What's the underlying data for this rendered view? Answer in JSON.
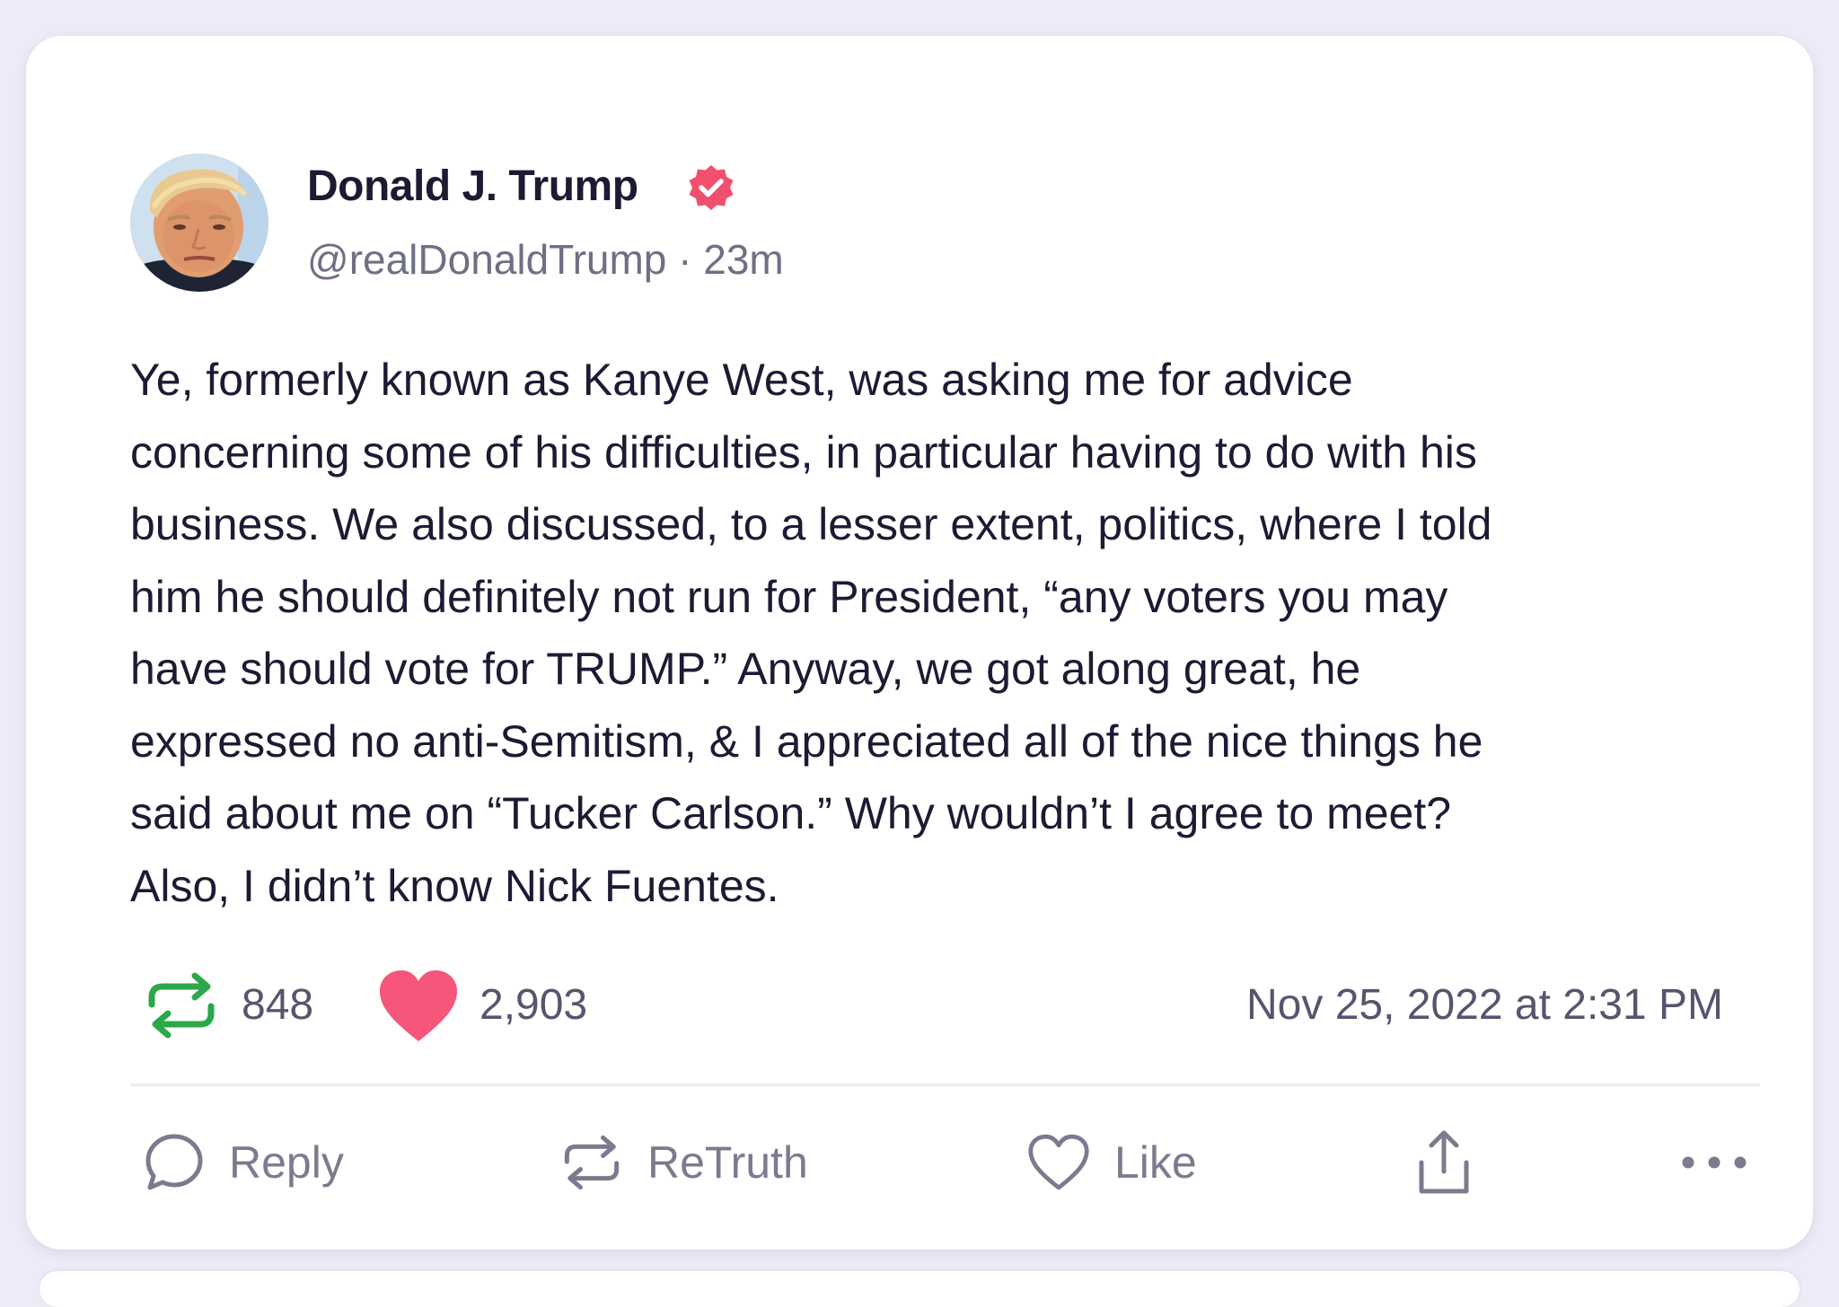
{
  "post": {
    "author": {
      "display_name": "Donald J. Trump",
      "handle": "@realDonaldTrump",
      "relative_time": "23m",
      "handle_line": "@realDonaldTrump · 23m",
      "verified": true
    },
    "body_lines": [
      "Ye, formerly known as Kanye West, was asking me for advice",
      "concerning some of his difficulties, in particular having to do with his",
      "business. We also discussed, to a lesser extent, politics, where I told",
      "him he should definitely not run for President, “any voters you may",
      "have should vote for TRUMP.” Anyway, we got along great, he",
      "expressed no anti-Semitism, & I appreciated all of the nice things he",
      "said about me on “Tucker Carlson.” Why wouldn’t I agree to meet?",
      "Also, I didn’t know Nick Fuentes."
    ],
    "stats": {
      "retruths": "848",
      "likes": "2,903",
      "timestamp": "Nov 25, 2022 at 2:31 PM"
    }
  },
  "actions": {
    "reply_label": "Reply",
    "retruth_label": "ReTruth",
    "like_label": "Like"
  },
  "icons": {
    "verified": "verified-badge-icon",
    "retruth_stat": "retruth-icon",
    "like_stat": "heart-filled-icon",
    "reply": "speech-bubble-icon",
    "retruth": "retruth-icon",
    "like": "heart-outline-icon",
    "share": "share-upload-icon",
    "more": "more-dots-icon"
  },
  "colors": {
    "page_background": "#ececf8",
    "card_background": "#ffffff",
    "verified_badge": "#f0506e",
    "retruth_green": "#2aa84a",
    "like_pink": "#f5567a",
    "text_primary": "#1c1b33",
    "text_secondary": "#6f6f85",
    "action_gray": "#7b7b8f"
  }
}
